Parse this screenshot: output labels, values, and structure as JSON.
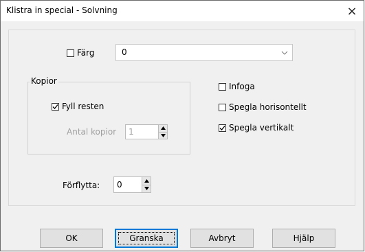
{
  "window": {
    "title": "Klistra in special - Solvning",
    "close_glyph": "×"
  },
  "color": {
    "label": "Färg",
    "checked": false,
    "combo_value": "0"
  },
  "copies": {
    "group_label": "Kopior",
    "fill_rest_label": "Fyll resten",
    "fill_rest_checked": true,
    "count_label": "Antal kopior",
    "count_value": "1"
  },
  "options": {
    "insert_label": "Infoga",
    "insert_checked": false,
    "mirror_h_label": "Spegla horisontellt",
    "mirror_h_checked": false,
    "mirror_v_label": "Spegla vertikalt",
    "mirror_v_checked": true
  },
  "move": {
    "label": "Förflytta:",
    "value": "0"
  },
  "buttons": {
    "ok": "OK",
    "preview": "Granska",
    "cancel": "Avbryt",
    "help": "Hjälp"
  }
}
